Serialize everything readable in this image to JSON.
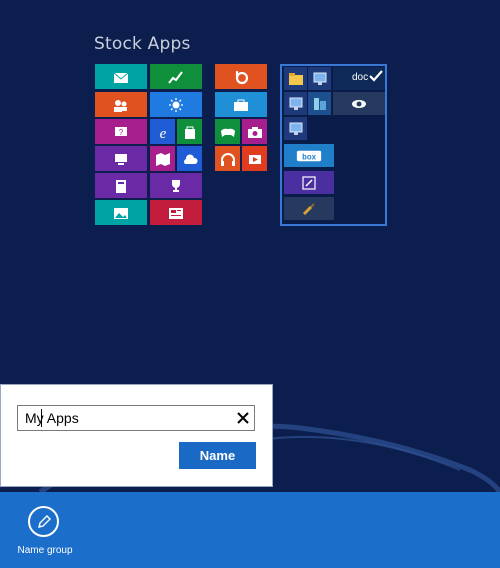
{
  "start_screen": {
    "group_title": "Stock Apps",
    "selected_group": {
      "doc_tile_label": "doc"
    },
    "colors": {
      "background": "#0c1e4d",
      "accent_blue": "#1b6ec9",
      "selection_border": "#3a78d6"
    }
  },
  "tiles": [
    {
      "name": "mail-tile",
      "icon": "mail-icon",
      "color": "#00a3a3"
    },
    {
      "name": "finance-tile",
      "icon": "chart-icon",
      "color": "#0f8f3c"
    },
    {
      "name": "people-tile",
      "icon": "people-icon",
      "color": "#e0521f"
    },
    {
      "name": "weather-tile",
      "icon": "sun-icon",
      "color": "#1f7be0"
    },
    {
      "name": "help-tile",
      "icon": "help-icon",
      "color": "#a61f8c"
    },
    {
      "name": "internet-explorer-tile",
      "icon": "ie-icon",
      "color": "#1f5cd6"
    },
    {
      "name": "store-tile",
      "icon": "store-icon",
      "color": "#0f8f3c"
    },
    {
      "name": "desktop-tile",
      "icon": "desktop-icon",
      "color": "#6a2aa6"
    },
    {
      "name": "maps-tile",
      "icon": "map-icon",
      "color": "#a61f8c"
    },
    {
      "name": "onedrive-tile",
      "icon": "cloud-icon",
      "color": "#1f5cd6"
    },
    {
      "name": "calculator-tile",
      "icon": "calculator-icon",
      "color": "#6a2aa6"
    },
    {
      "name": "sports-tile",
      "icon": "trophy-icon",
      "color": "#6a2aa6"
    },
    {
      "name": "photos-tile",
      "icon": "photo-icon",
      "color": "#00a3a3"
    },
    {
      "name": "news-tile",
      "icon": "news-icon",
      "color": "#c21d3d"
    },
    {
      "name": "bing-tile",
      "icon": "bing-icon",
      "color": "#e0521f"
    },
    {
      "name": "travel-tile",
      "icon": "suitcase-icon",
      "color": "#1f8fd6"
    },
    {
      "name": "games-tile",
      "icon": "gamepad-icon",
      "color": "#0f8f3c"
    },
    {
      "name": "camera-tile",
      "icon": "camera-icon",
      "color": "#a61f8c"
    },
    {
      "name": "music-tile",
      "icon": "headphones-icon",
      "color": "#e0521f"
    },
    {
      "name": "video-tile",
      "icon": "video-icon",
      "color": "#e03c1f"
    }
  ],
  "dialog": {
    "input_value": "My Apps",
    "name_button_label": "Name"
  },
  "app_bar": {
    "command_label": "Name group",
    "command_icon": "pencil-icon"
  }
}
